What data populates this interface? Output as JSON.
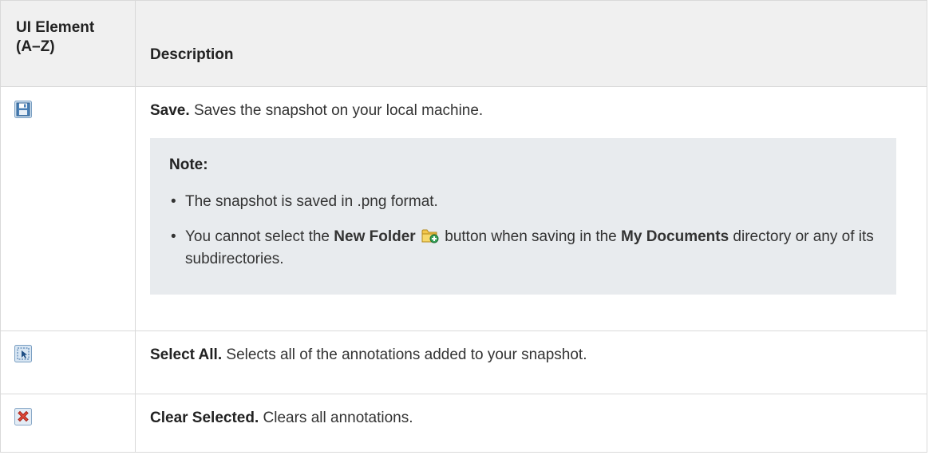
{
  "table": {
    "header": {
      "ui_element": "UI Element (A–Z)",
      "description": "Description"
    },
    "rows": [
      {
        "icon": "save-disk-icon",
        "term": "Save.",
        "text": "Saves the snapshot on your local machine.",
        "note": {
          "title": "Note:",
          "items": [
            {
              "text": "The snapshot is saved in .png format."
            },
            {
              "part1": "You cannot select the ",
              "bold1": "New Folder",
              "icon": "new-folder-icon",
              "part2": " button when saving in the ",
              "bold2": "My Documents",
              "part3": " directory or any of its subdirectories."
            }
          ]
        }
      },
      {
        "icon": "select-all-icon",
        "term": "Select All.",
        "text": "Selects all of the annotations added to your snapshot."
      },
      {
        "icon": "clear-selected-icon",
        "term": "Clear Selected.",
        "text": "Clears all annotations."
      }
    ]
  },
  "colors": {
    "header_bg": "#f0f0f0",
    "note_bg": "#e8ebee",
    "border": "#d9d9d9"
  }
}
